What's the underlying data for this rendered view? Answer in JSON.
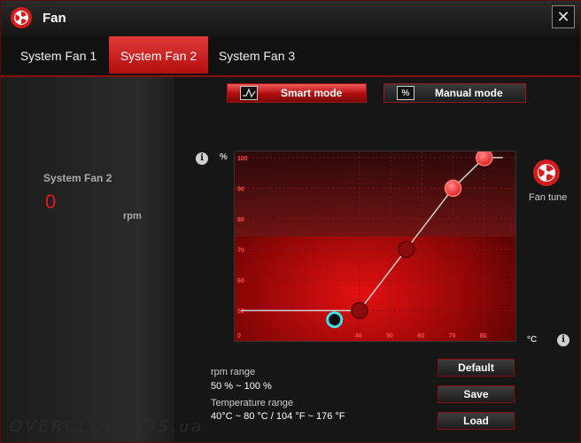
{
  "window": {
    "title": "Fan"
  },
  "tabs": [
    {
      "label": "System Fan 1",
      "active": false
    },
    {
      "label": "System Fan 2",
      "active": true
    },
    {
      "label": "System Fan 3",
      "active": false
    }
  ],
  "left_panel": {
    "fan_name": "System Fan 2",
    "rpm_value": "0",
    "rpm_unit": "rpm"
  },
  "modes": {
    "smart_label": "Smart mode",
    "manual_label": "Manual mode",
    "selected": "smart",
    "smart_icon": "curve-icon",
    "manual_icon": "%"
  },
  "chart_units": {
    "y": "%",
    "x": "°C"
  },
  "chart_data": {
    "type": "line",
    "x_ticks": [
      "0",
      "40",
      "50",
      "60",
      "70",
      "80"
    ],
    "y_ticks": [
      "50",
      "60",
      "70",
      "80",
      "90",
      "100"
    ],
    "series": [
      {
        "points": [
          [
            2,
            50
          ],
          [
            40,
            50
          ],
          [
            55,
            70
          ],
          [
            70,
            90
          ],
          [
            80,
            100
          ],
          [
            86,
            100
          ]
        ]
      }
    ],
    "draggable_points": [
      [
        40,
        50
      ],
      [
        55,
        70
      ],
      [
        70,
        90
      ],
      [
        80,
        100
      ]
    ],
    "current_point": [
      32,
      47
    ],
    "xlim": [
      0,
      90
    ],
    "ylim": [
      40,
      102
    ]
  },
  "fan_tune": {
    "label": "Fan tune"
  },
  "ranges": {
    "rpm_label": "rpm range",
    "rpm_value": "50 % ~ 100 %",
    "temp_label": "Temperature range",
    "temp_value": "40°C ~ 80 °C / 104 °F ~ 176 °F"
  },
  "buttons": {
    "default": "Default",
    "save": "Save",
    "load": "Load"
  },
  "watermark": "OVERCLOCKERS.ua",
  "colors": {
    "accent": "#e21b1b",
    "dark_red": "#7a0808"
  }
}
